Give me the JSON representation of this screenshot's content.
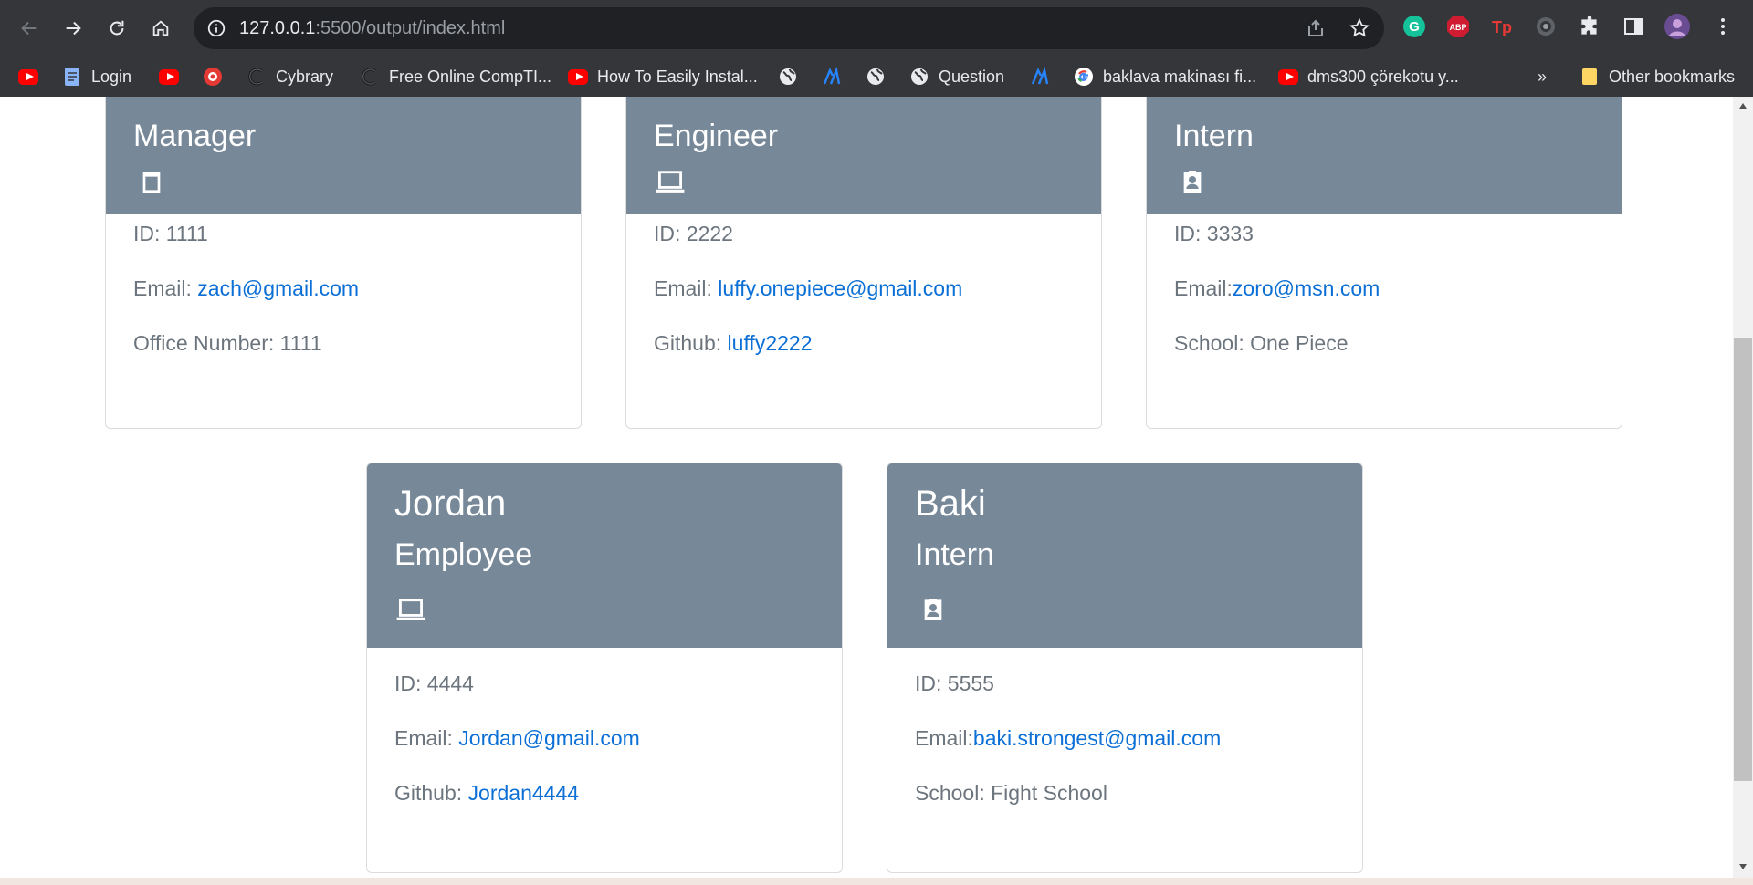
{
  "browser": {
    "url_host": "127.0.0.1",
    "url_rest": ":5500/output/index.html",
    "bookmarks": [
      {
        "label": "",
        "icon": "youtube-icon"
      },
      {
        "label": "Login",
        "icon": "document-icon"
      },
      {
        "label": "",
        "icon": "youtube-icon"
      },
      {
        "label": "",
        "icon": "red-circle-icon"
      },
      {
        "label": "Cybrary",
        "icon": "cybrary-icon"
      },
      {
        "label": "Free Online CompTI...",
        "icon": "cybrary-icon"
      },
      {
        "label": "How To Easily Instal...",
        "icon": "youtube-icon"
      },
      {
        "label": "",
        "icon": "globe-icon"
      },
      {
        "label": "",
        "icon": "atlassian-icon"
      },
      {
        "label": "",
        "icon": "globe-icon"
      },
      {
        "label": "Question",
        "icon": "globe-icon"
      },
      {
        "label": "",
        "icon": "atlassian-icon"
      },
      {
        "label": "baklava makinası fi...",
        "icon": "google-icon"
      },
      {
        "label": "dms300 çörekotu y...",
        "icon": "youtube-icon"
      }
    ],
    "overflow": "»",
    "other_bookmarks": "Other bookmarks"
  },
  "cards": [
    {
      "name": "",
      "role": "Manager",
      "icon": "clipboard-icon",
      "id_label": "ID: 1111",
      "email_label": "Email: ",
      "email": "zach@gmail.com",
      "extra_label": "Office Number: 1111",
      "extra_link": ""
    },
    {
      "name": "",
      "role": "Engineer",
      "icon": "laptop-icon",
      "id_label": "ID: 2222",
      "email_label": "Email: ",
      "email": "luffy.onepiece@gmail.com",
      "extra_label": "Github: ",
      "extra_link": "luffy2222"
    },
    {
      "name": "",
      "role": "Intern",
      "icon": "badge-icon",
      "id_label": "ID: 3333",
      "email_label": "Email:",
      "email": "zoro@msn.com",
      "extra_label": "School: One Piece",
      "extra_link": ""
    },
    {
      "name": "Jordan",
      "role": "Employee",
      "icon": "laptop-icon",
      "id_label": "ID: 4444",
      "email_label": "Email: ",
      "email": "Jordan@gmail.com",
      "extra_label": "Github: ",
      "extra_link": "Jordan4444"
    },
    {
      "name": "Baki",
      "role": "Intern",
      "icon": "badge-icon",
      "id_label": "ID: 5555",
      "email_label": "Email:",
      "email": "baki.strongest@gmail.com",
      "extra_label": "School: Fight School",
      "extra_link": ""
    }
  ]
}
